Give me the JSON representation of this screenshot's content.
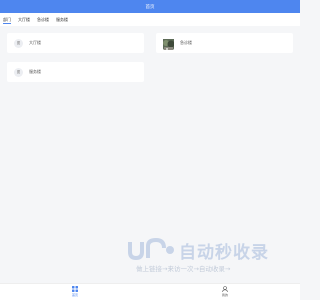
{
  "header": {
    "title": "首页"
  },
  "tabs": [
    {
      "label": "部门"
    },
    {
      "label": "大厅楼"
    },
    {
      "label": "急诊楼"
    },
    {
      "label": "服务楼"
    }
  ],
  "cards": [
    {
      "avatar": "图",
      "label": "大厅楼"
    },
    {
      "avatar": "",
      "label": "急诊楼"
    },
    {
      "avatar": "图",
      "label": "服务楼"
    }
  ],
  "watermark": {
    "title": "自动秒收录",
    "subtitle": "做上链接→来访一次→自动收录→"
  },
  "bottom_nav": [
    {
      "label": "首页",
      "icon": "grid-icon"
    },
    {
      "label": "我的",
      "icon": "user-icon"
    }
  ],
  "colors": {
    "accent": "#4e86ef",
    "background": "#f5f6f8"
  }
}
